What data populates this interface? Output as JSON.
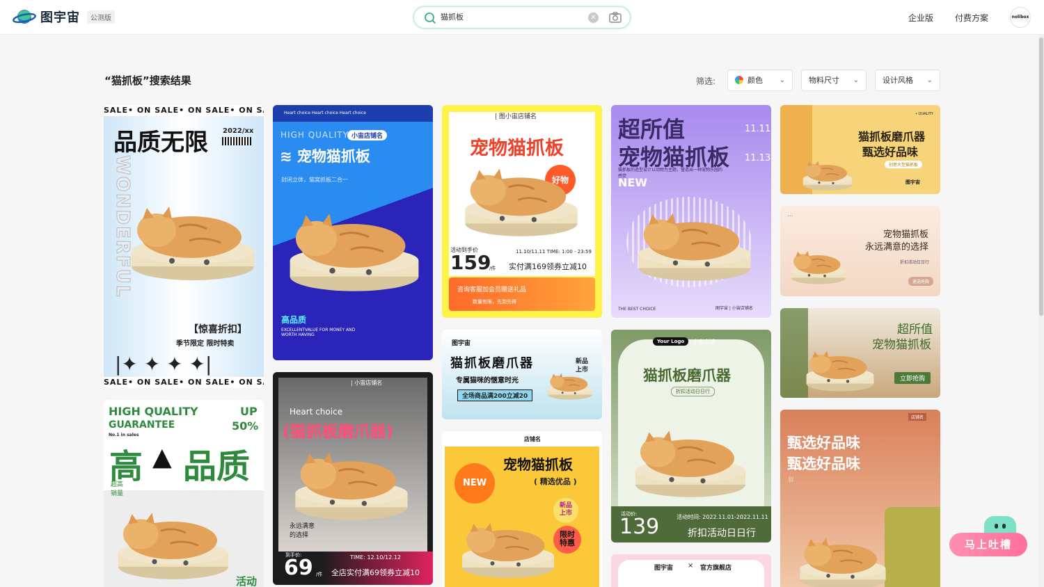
{
  "header": {
    "logo_text": "图宇宙",
    "beta_badge": "公测版",
    "search": {
      "value": "猫抓板",
      "placeholder": ""
    },
    "nav": {
      "enterprise": "企业版",
      "pricing": "付费方案"
    },
    "avatar_text": "nolibox"
  },
  "results": {
    "title": "“猫抓板”搜索结果",
    "filter_label": "筛选:",
    "filters": {
      "color": "颜色",
      "size": "物料尺寸",
      "style": "设计风格"
    }
  },
  "cards": {
    "c1": {
      "banner": "SALE• ON  SALE• ON  SALE• ON  SA",
      "title": "品质无限",
      "date": "2022/xx",
      "side": "WONDERFUL",
      "promo": "【惊喜折扣】",
      "sub": "季节限定    限时特卖",
      "banner2": "SALE• ON  SALE• ON  SALE• ON  SA"
    },
    "c2": {
      "top": "Heart choice     Heart choice     Heart choice",
      "hq": "HIGH QUALITY",
      "shop": "小宙店铺名",
      "title": "宠物猫抓板",
      "sub": "封闭立体，猫窝抓板二合一",
      "q": "高品质",
      "en": "EXCELLENTVALUE FOR MONEY AND WORTH HAVING"
    },
    "c3": {
      "shop": "| 图小宙店铺名",
      "title": "宠物猫抓板",
      "badge": "好物",
      "price_label": "活动到手价",
      "price": "159",
      "unit": "/件",
      "time": "11.10/11.11  TIME: 1:00 - 23:59",
      "offer": "实付满169领券立减10",
      "gift": "咨询客服加会员赠送礼品",
      "limit": "数量有限，先到先得"
    },
    "c4": {
      "title1": "超所值",
      "title2": "宠物猫抓板",
      "dates": "11.11",
      "dates2": "11.13",
      "desc": "猫抓板的造型设计以动物为主题，营造出一种宠物乐园的感觉",
      "new": "NEW",
      "foot": "THE BEST CHOICE",
      "brand": "图宇宙 | 小宙店铺名"
    },
    "c5": {
      "q": "• QUALITY",
      "title1": "猫抓板磨爪器",
      "title2": "甄选好品味",
      "pill": "创意大型猫抓板",
      "brand": "图宇宙"
    },
    "c6": {
      "dots": "...",
      "title1": "宠物猫抓板",
      "title2": "永远满意的选择",
      "sub": "折扣活动日日行",
      "btn": "速选抢购"
    },
    "c7": {
      "title1": "超所值",
      "title2": "宠物猫抓板",
      "btn": "立即抢购"
    },
    "c8": {
      "hq": "HIGH QUALITY",
      "up": "UP",
      "guarantee": "GUARANTEE",
      "pct": "50%",
      "no1": "No.1 in sales",
      "big1": "高",
      "big2": "品质",
      "l1": "超高",
      "l2": "销量",
      "foot": "活动"
    },
    "c9": {
      "shop": "| 小宙店铺名",
      "hc": "Heart choice",
      "title": "(猫抓板磨爪器)",
      "s1": "永远满意",
      "s2": "的选择",
      "price_label": "到手价:",
      "price": "69",
      "unit": "/件",
      "time": "TIME: 12.10/12.12",
      "offer": "全店实付满69领券立减10"
    },
    "c10": {
      "brand": "图宇宙",
      "title": "猫抓板磨爪器",
      "sub": "专属猫咪的惬意时光",
      "pill": "全场商品满200立减20",
      "burst1": "新品",
      "burst2": "上市"
    },
    "c11": {
      "shop": "店铺名",
      "title": "宠物猫抓板",
      "sub": "( 精选优品 )",
      "new": "NEW",
      "b1": "新品",
      "b2": "上市",
      "r1": "限时",
      "r2": "特惠"
    },
    "c12": {
      "logo": "Your Logo",
      "shop": "| 小宙店铺",
      "title": "猫抓板磨爪器",
      "sub": "折扣活动日日行",
      "price_label": "活动价:",
      "price": "139",
      "time": "活动时间: 2022.11.01-2022.11.11",
      "offer": "折扣活动日日行"
    },
    "c13": {
      "brand": "图宇宙",
      "x": "×",
      "store": "官方旗舰店"
    },
    "c14": {
      "shop": "店铺名",
      "l1": "甄选好品味",
      "l2": "甄选好品味",
      "mark": "|||"
    }
  },
  "feedback": {
    "label": "马上吐槽"
  },
  "colors": {
    "accent": "#2bb48a",
    "search_border": "#b7e2d0"
  }
}
